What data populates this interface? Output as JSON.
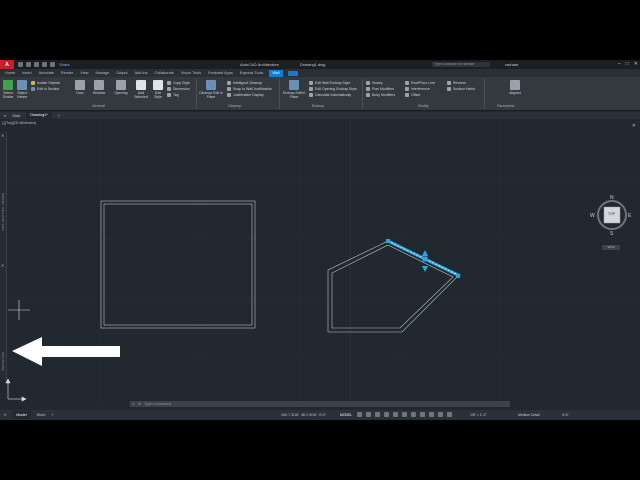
{
  "titlebar": {
    "app_button": "A",
    "share": "Share",
    "app_name": "AutoCAD Architecture",
    "file_name": "Drawing1.dwg",
    "search_placeholder": "Type a keyword or phrase",
    "user": "rachant"
  },
  "ribbon_tabs": [
    "Home",
    "Insert",
    "Annotate",
    "Render",
    "View",
    "Manage",
    "Output",
    "Add-ins",
    "Collaborate",
    "Vision Tools",
    "Featured Apps",
    "Express Tools",
    "Wall"
  ],
  "active_tab": "Wall",
  "ribbon": {
    "general": {
      "label": "General",
      "select_similar": "Select Similar",
      "object_viewer": "Object Viewer",
      "isolate_objects": "Isolate Objects",
      "edit_in_section": "Edit in Section",
      "door": "Door",
      "window": "Window",
      "opening": "Opening",
      "add_selected": "Add Selected",
      "edit_style": "Edit Style",
      "copy_style": "Copy Style",
      "dimension": "Dimension",
      "tag": "Tag"
    },
    "cleanup": {
      "label": "Cleanup",
      "cleanup_edit": "Cleanup Edit in Place",
      "intelligent_cleanup": "Intelligent Cleanup",
      "snap_to_wall": "Snap to Wall Justification",
      "justification_display": "Justification Display"
    },
    "endcap": {
      "label": "Endcap",
      "endcap_edit": "Endcap Edit in Place",
      "edit_wall_endcap_style": "Edit Wall Endcap Style",
      "edit_opening_endcap_style": "Edit Opening Endcap Style",
      "calculate_automatically": "Calculate Automatically"
    },
    "modify": {
      "label": "Modify",
      "sweep": "Sweep",
      "plan_modifiers": "Plan Modifiers",
      "body_modifiers": "Body Modifiers",
      "roof_floor_line": "Roof/Floor Line",
      "interference": "Interference",
      "offset": "Offset",
      "reverse": "Reverse",
      "surface_hatch": "Surface Hatch"
    },
    "parametric": {
      "label": "Parametric",
      "aligned": "Aligned"
    }
  },
  "file_tabs": [
    "Start",
    "Drawing1*"
  ],
  "viewport": {
    "label": "[-][Top][2D Wireframe]",
    "viewcube": {
      "top": "TOP",
      "n": "N",
      "s": "S",
      "e": "E",
      "w": "W"
    },
    "wcs": "WCS",
    "side_palette_labels": [
      "TOOL PALETTES - DESIGN",
      "PROPERTIES"
    ]
  },
  "command_line": {
    "placeholder": "Type a command"
  },
  "statusbar": {
    "layout_tabs": [
      "Model",
      "Work"
    ],
    "coordinates": "154'-7 3/16\", 38'-2 9/16\", 0'-0\"",
    "model": "MODEL",
    "scale": "1/8\" = 1'-0\"",
    "detail": "Medium Detail",
    "cut_plane": "3'-6\""
  },
  "colors": {
    "background": "#212830",
    "wall_line": "#b8c9c4",
    "selection_blue": "#2aa6e0",
    "accent": "#0f7fd1"
  }
}
